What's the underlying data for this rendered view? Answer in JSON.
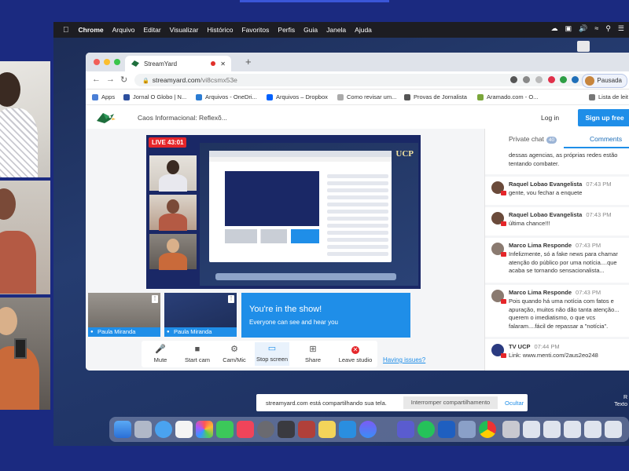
{
  "menubar": {
    "app": "Chrome",
    "items": [
      "Arquivo",
      "Editar",
      "Visualizar",
      "Histórico",
      "Favoritos",
      "Perfis",
      "Guia",
      "Janela",
      "Ajuda"
    ]
  },
  "browser": {
    "tab_title": "StreamYard",
    "url_host": "streamyard.com",
    "url_path": "/vi8csmx53e",
    "profile_label": "Pausada",
    "bookmarks": [
      "Apps",
      "Jornal O Globo | N...",
      "Arquivos - OneDri...",
      "Arquivos – Dropbox",
      "Como revisar um...",
      "Provas de Jornalista",
      "Aramado.com - O...",
      "Lista de leit"
    ]
  },
  "streamyard": {
    "breadcrumb": "Caos Informacional: Reflexõ...",
    "login": "Log in",
    "signup": "Sign up free",
    "live_badge": "LIVE 43:01",
    "tiles": [
      {
        "name": "Paula Miranda"
      },
      {
        "name": "Paula Miranda"
      }
    ],
    "show_title": "You're in the show!",
    "show_subtitle": "Everyone can see and hear you",
    "controls": [
      "Mute",
      "Start cam",
      "Cam/Mic",
      "Stop screen",
      "Share",
      "Leave studio"
    ],
    "issues_link": "Having issues?"
  },
  "chat": {
    "tab_private": "Private chat",
    "private_count": "40",
    "tab_comments": "Comments",
    "partial_lines": [
      "dessas agencias, as próprias redes estão",
      "tentando combater."
    ],
    "messages": [
      {
        "name": "Raquel Lobao Evangelista",
        "time": "07:43 PM",
        "lines": [
          "gente, vou fechar a enquete"
        ]
      },
      {
        "name": "Raquel Lobao Evangelista",
        "time": "07:43 PM",
        "lines": [
          "última chance!!!"
        ]
      },
      {
        "name": "Marco Lima Responde",
        "time": "07:43 PM",
        "lines": [
          "Infelizmente, só a fake news para chamar",
          "atenção do público por uma notícia....que",
          "acaba se tornando sensacionalista..."
        ]
      },
      {
        "name": "Marco Lima Responde",
        "time": "07:43 PM",
        "lines": [
          "Pois quando há uma notícia com fatos e",
          "apuração, muitos não dão tanta atenção...",
          "querem o imediatismo, o que vcs",
          "falaram....fácil de repassar a \"notícia\"."
        ]
      },
      {
        "name": "TV UCP",
        "time": "07:44 PM",
        "lines": [
          "Link: www.menti.com/2aus2eo248"
        ]
      }
    ]
  },
  "sharebar": {
    "message": "streamyard.com está compartilhando sua tela.",
    "stop": "Interromper compartilhamento",
    "hide": "Ocultar"
  },
  "inner": {
    "logo": "UCP"
  },
  "side": {
    "line1": "R",
    "line2": "Texto"
  },
  "colors": {
    "accent": "#1f8ee8",
    "live": "#e5262a",
    "background": "#1b2a80"
  }
}
